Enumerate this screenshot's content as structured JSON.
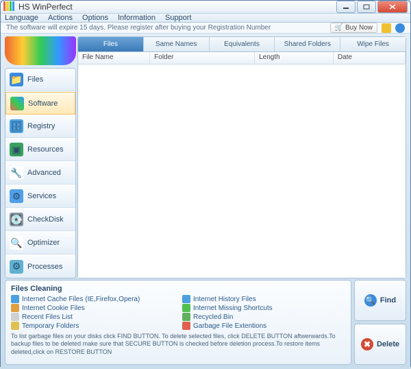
{
  "window": {
    "title": "HS WinPerfect"
  },
  "menu": [
    "Language",
    "Actions",
    "Options",
    "Information",
    "Support"
  ],
  "notice": {
    "text": "The software will expire 15 days. Please register after buying your Registration Number",
    "buy": "Buy Now"
  },
  "nav": [
    {
      "label": "Files",
      "icon": "folder",
      "color": "#3a8ade"
    },
    {
      "label": "Software",
      "icon": "cube",
      "color": "#e65050"
    },
    {
      "label": "Registry",
      "icon": "db",
      "color": "#4aa0e0"
    },
    {
      "label": "Resources",
      "icon": "chip",
      "color": "#3aa060"
    },
    {
      "label": "Advanced",
      "icon": "tool",
      "color": "#e07030"
    },
    {
      "label": "Services",
      "icon": "gear",
      "color": "#50a0e8"
    },
    {
      "label": "CheckDisk",
      "icon": "disk",
      "color": "#8898a8"
    },
    {
      "label": "Optimizer",
      "icon": "search",
      "color": "#50a0e8"
    },
    {
      "label": "Processes",
      "icon": "proc",
      "color": "#60b0d0"
    }
  ],
  "tabs": [
    "Files",
    "Same Names",
    "Equivalents",
    "Shared Folders",
    "Wipe Files"
  ],
  "columns": [
    "File Name",
    "Folder",
    "Length",
    "Date"
  ],
  "cleaning": {
    "title": "Files Cleaning",
    "items_left": [
      "Internet Cache Files (IE,Firefox,Opera)",
      "Internet Cookie Files",
      "Recent Files List",
      "Temporary Folders"
    ],
    "items_right": [
      "Internet History Files",
      "Internet Missing Shortcuts",
      "Recycled Bin",
      "Garbage File Extentions"
    ],
    "help": "To list garbage files on your disks click FIND BUTTON. To delete selected files, click DELETE BUTTON aftwerwards.To backup files to be deleted make sure that SECURE BUTTON is checked before deletion process.To restore items deleted,click on RESTORE BUTTON"
  },
  "actions": {
    "find": "Find",
    "delete": "Delete"
  }
}
